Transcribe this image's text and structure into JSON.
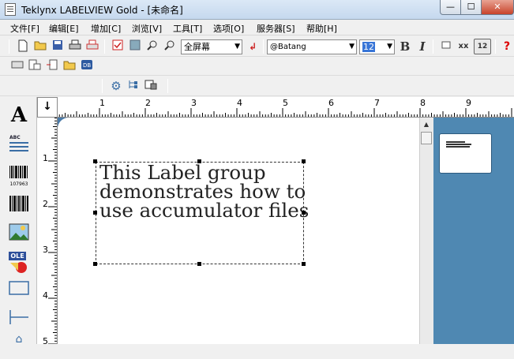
{
  "window": {
    "title": "Teklynx LABELVIEW Gold - [未命名]",
    "controls": {
      "minimize": "—",
      "maximize": "☐",
      "close": "✕"
    }
  },
  "menu": [
    "文件[F]",
    "编辑[E]",
    "增加[C]",
    "浏览[V]",
    "工具[T]",
    "选项[O]",
    "服务器[S]",
    "帮助[H]"
  ],
  "toolbar": {
    "zoom": "全屏幕",
    "font": "@Batang",
    "font_size": "12",
    "bold": "B",
    "italic": "I",
    "strike": "xx",
    "size_badge": "12",
    "help": "?"
  },
  "ruler": {
    "corner_arrow": "↓",
    "h_labels": [
      "1",
      "2",
      "3",
      "4",
      "5",
      "6",
      "7",
      "8",
      "9"
    ],
    "v_labels": [
      "1",
      "2",
      "3",
      "4",
      "5"
    ]
  },
  "label": {
    "lines": [
      "This Label group",
      "demonstrates how to",
      "use accumulator files"
    ]
  },
  "palette": {
    "text_tool": "A",
    "text_lines_tool": "ABC",
    "barcode_number": "107963",
    "ole_label": "OLE"
  },
  "preview": {
    "lines": 3
  }
}
